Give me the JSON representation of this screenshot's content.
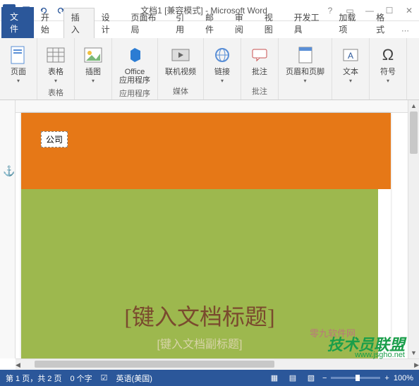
{
  "titlebar": {
    "app_letter": "W",
    "title": "文档1 [兼容模式] - Microsoft Word"
  },
  "tabs": {
    "file": "文件",
    "items": [
      "开始",
      "插入",
      "设计",
      "页面布局",
      "引用",
      "邮件",
      "审阅",
      "视图",
      "开发工具",
      "加载项",
      "格式"
    ],
    "active_index": 1
  },
  "ribbon": {
    "groups": [
      {
        "name": "",
        "items": [
          {
            "label": "页面"
          }
        ]
      },
      {
        "name": "表格",
        "items": [
          {
            "label": "表格"
          }
        ]
      },
      {
        "name": "",
        "items": [
          {
            "label": "插图"
          }
        ]
      },
      {
        "name": "应用程序",
        "items": [
          {
            "label": "Office\n应用程序"
          }
        ]
      },
      {
        "name": "媒体",
        "items": [
          {
            "label": "联机视频"
          }
        ]
      },
      {
        "name": "",
        "items": [
          {
            "label": "链接"
          }
        ]
      },
      {
        "name": "批注",
        "items": [
          {
            "label": "批注"
          }
        ]
      },
      {
        "name": "",
        "items": [
          {
            "label": "页眉和页脚"
          }
        ]
      },
      {
        "name": "",
        "items": [
          {
            "label": "文本"
          }
        ]
      },
      {
        "name": "",
        "items": [
          {
            "label": "符号"
          }
        ]
      }
    ]
  },
  "document": {
    "company_placeholder": "公司",
    "title_placeholder": "[键入文档标题]",
    "subtitle_placeholder": "[键入文档副标题]"
  },
  "statusbar": {
    "page_info": "第 1 页，共 2 页",
    "word_count": "0 个字",
    "language": "英语(美国)",
    "zoom": "100%"
  },
  "watermark": {
    "text": "技术员联盟",
    "url": "www.jsgho.net",
    "text2": "零九软件网"
  }
}
